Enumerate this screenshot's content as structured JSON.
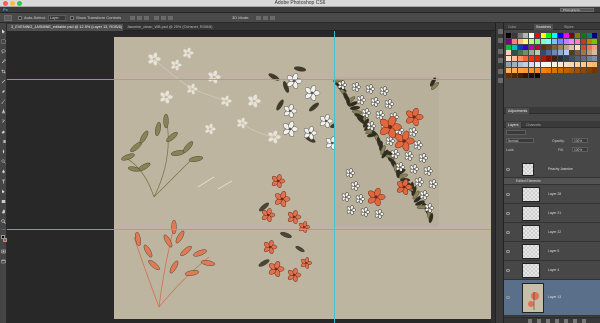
{
  "window": {
    "title": "Adobe Photoshop CS6",
    "traffic_colors": [
      "#fc605c",
      "#fdbc40",
      "#34c84a"
    ]
  },
  "appbar": {
    "logo": "Ps",
    "workspace": "Photography"
  },
  "options": {
    "auto_select_label": "Auto-Select:",
    "auto_select_value": "Layer",
    "transform_label": "Show Transform Controls",
    "mode_label": "3D Mode:"
  },
  "tabs": [
    {
      "label": "3_EVENING_JASMINE_editable.psd @ 12.5% (Layer 13, RGB/8) *",
      "active": true
    },
    {
      "label": "Jasmine_clean_WB.psd @ 25% (Ochsner, RGB/8)",
      "active": false
    }
  ],
  "panels": {
    "swatch_tabs": [
      "Swatches",
      "Color",
      "Styles"
    ],
    "swatch_colors": [
      "#000000",
      "#3a3a3a",
      "#777777",
      "#b5b5b5",
      "#ffffff",
      "#ff0000",
      "#ffff00",
      "#00ff00",
      "#00ffff",
      "#0000ff",
      "#ff00ff",
      "#7f0000",
      "#7f7f00",
      "#007f00",
      "#007f7f",
      "#00007f",
      "#7f007f",
      "#ff7f7f",
      "#ffbf7f",
      "#ffff7f",
      "#bfff7f",
      "#7fff7f",
      "#7fffbf",
      "#7fffff",
      "#7fbfff",
      "#7f7fff",
      "#bf7fff",
      "#ff7fff",
      "#ff7fbf",
      "#c04000",
      "#c08000",
      "#80c000",
      "#00c040",
      "#00c0c0",
      "#0040c0",
      "#4000c0",
      "#c000c0",
      "#c00040",
      "#603010",
      "#604020",
      "#806040",
      "#a08060",
      "#c0a080",
      "#e0c0a0",
      "#f0e0c0",
      "#d24a28",
      "#e87850",
      "#f4a080",
      "#fad0b8",
      "#2f4f4f",
      "#4f6f4f",
      "#6f8f6f",
      "#8faf8f",
      "#afcfaf",
      "#324a72",
      "#4e6a94",
      "#6e8ab4",
      "#8eaad4",
      "#aecaf4",
      "#5a3a1a",
      "#7a5a3a",
      "#9a7a5a",
      "#ba9a7a",
      "#daba9a",
      "#ffe0c0",
      "#ffc0a0",
      "#ff9070",
      "#ff6040",
      "#ff3010",
      "#e02000",
      "#b01800",
      "#801000",
      "#402010",
      "#203040",
      "#304050",
      "#405060",
      "#506070",
      "#607080",
      "#708090",
      "#8090a0",
      "#90a0b0",
      "#a0b0c0",
      "#b0c0d0",
      "#c0d0e0",
      "#d0e0f0",
      "#e0f0ff",
      "#f0f8ff",
      "#fff8f0",
      "#fff0e0",
      "#ffe8d0",
      "#ffe0c0",
      "#ffd8b0",
      "#ffd0a0",
      "#ffc890",
      "#ffc080",
      "#ffb870",
      "#ffb060",
      "#ffa850",
      "#ffa040",
      "#ff9830",
      "#ff9020",
      "#ff8810",
      "#ff8000",
      "#f07800",
      "#e07000",
      "#d06800",
      "#c06000",
      "#b05800",
      "#a05000",
      "#904800",
      "#804000",
      "#703800",
      "#603000",
      "#502800",
      "#402000",
      "#301800",
      "#201000",
      "#100800"
    ],
    "adjust_tabs": [
      "Adjustments",
      "Layers"
    ],
    "layers_tabs": [
      "Layers",
      "Channels"
    ],
    "blend_mode": "Normal",
    "opacity_label": "Opacity:",
    "opacity_value": "100%",
    "lock_label": "Lock:",
    "fill_label": "Fill:",
    "fill_value": "100%"
  },
  "layers": [
    {
      "name": "Peachy Jasmine",
      "type": "layer",
      "selected": false
    },
    {
      "name": "Edited Elements",
      "type": "group",
      "selected": false
    },
    {
      "name": "Layer 28",
      "type": "layer",
      "selected": false
    },
    {
      "name": "Layer 21",
      "type": "layer",
      "selected": false
    },
    {
      "name": "Layer 22",
      "type": "layer",
      "selected": false
    },
    {
      "name": "Layer 5",
      "type": "layer",
      "selected": false
    },
    {
      "name": "Layer 4",
      "type": "layer",
      "selected": false
    },
    {
      "name": "Layer 13",
      "type": "layer",
      "selected": true
    }
  ],
  "colors": {
    "canvas_bg": "#bdb59f",
    "guide": "#38c6d6",
    "foreground_swatch": "#000000",
    "background_swatch": "#d24a28",
    "coral_flowers": "#e07250",
    "olive_leaves": "#8a8256",
    "selection": "#5a6f8a"
  }
}
